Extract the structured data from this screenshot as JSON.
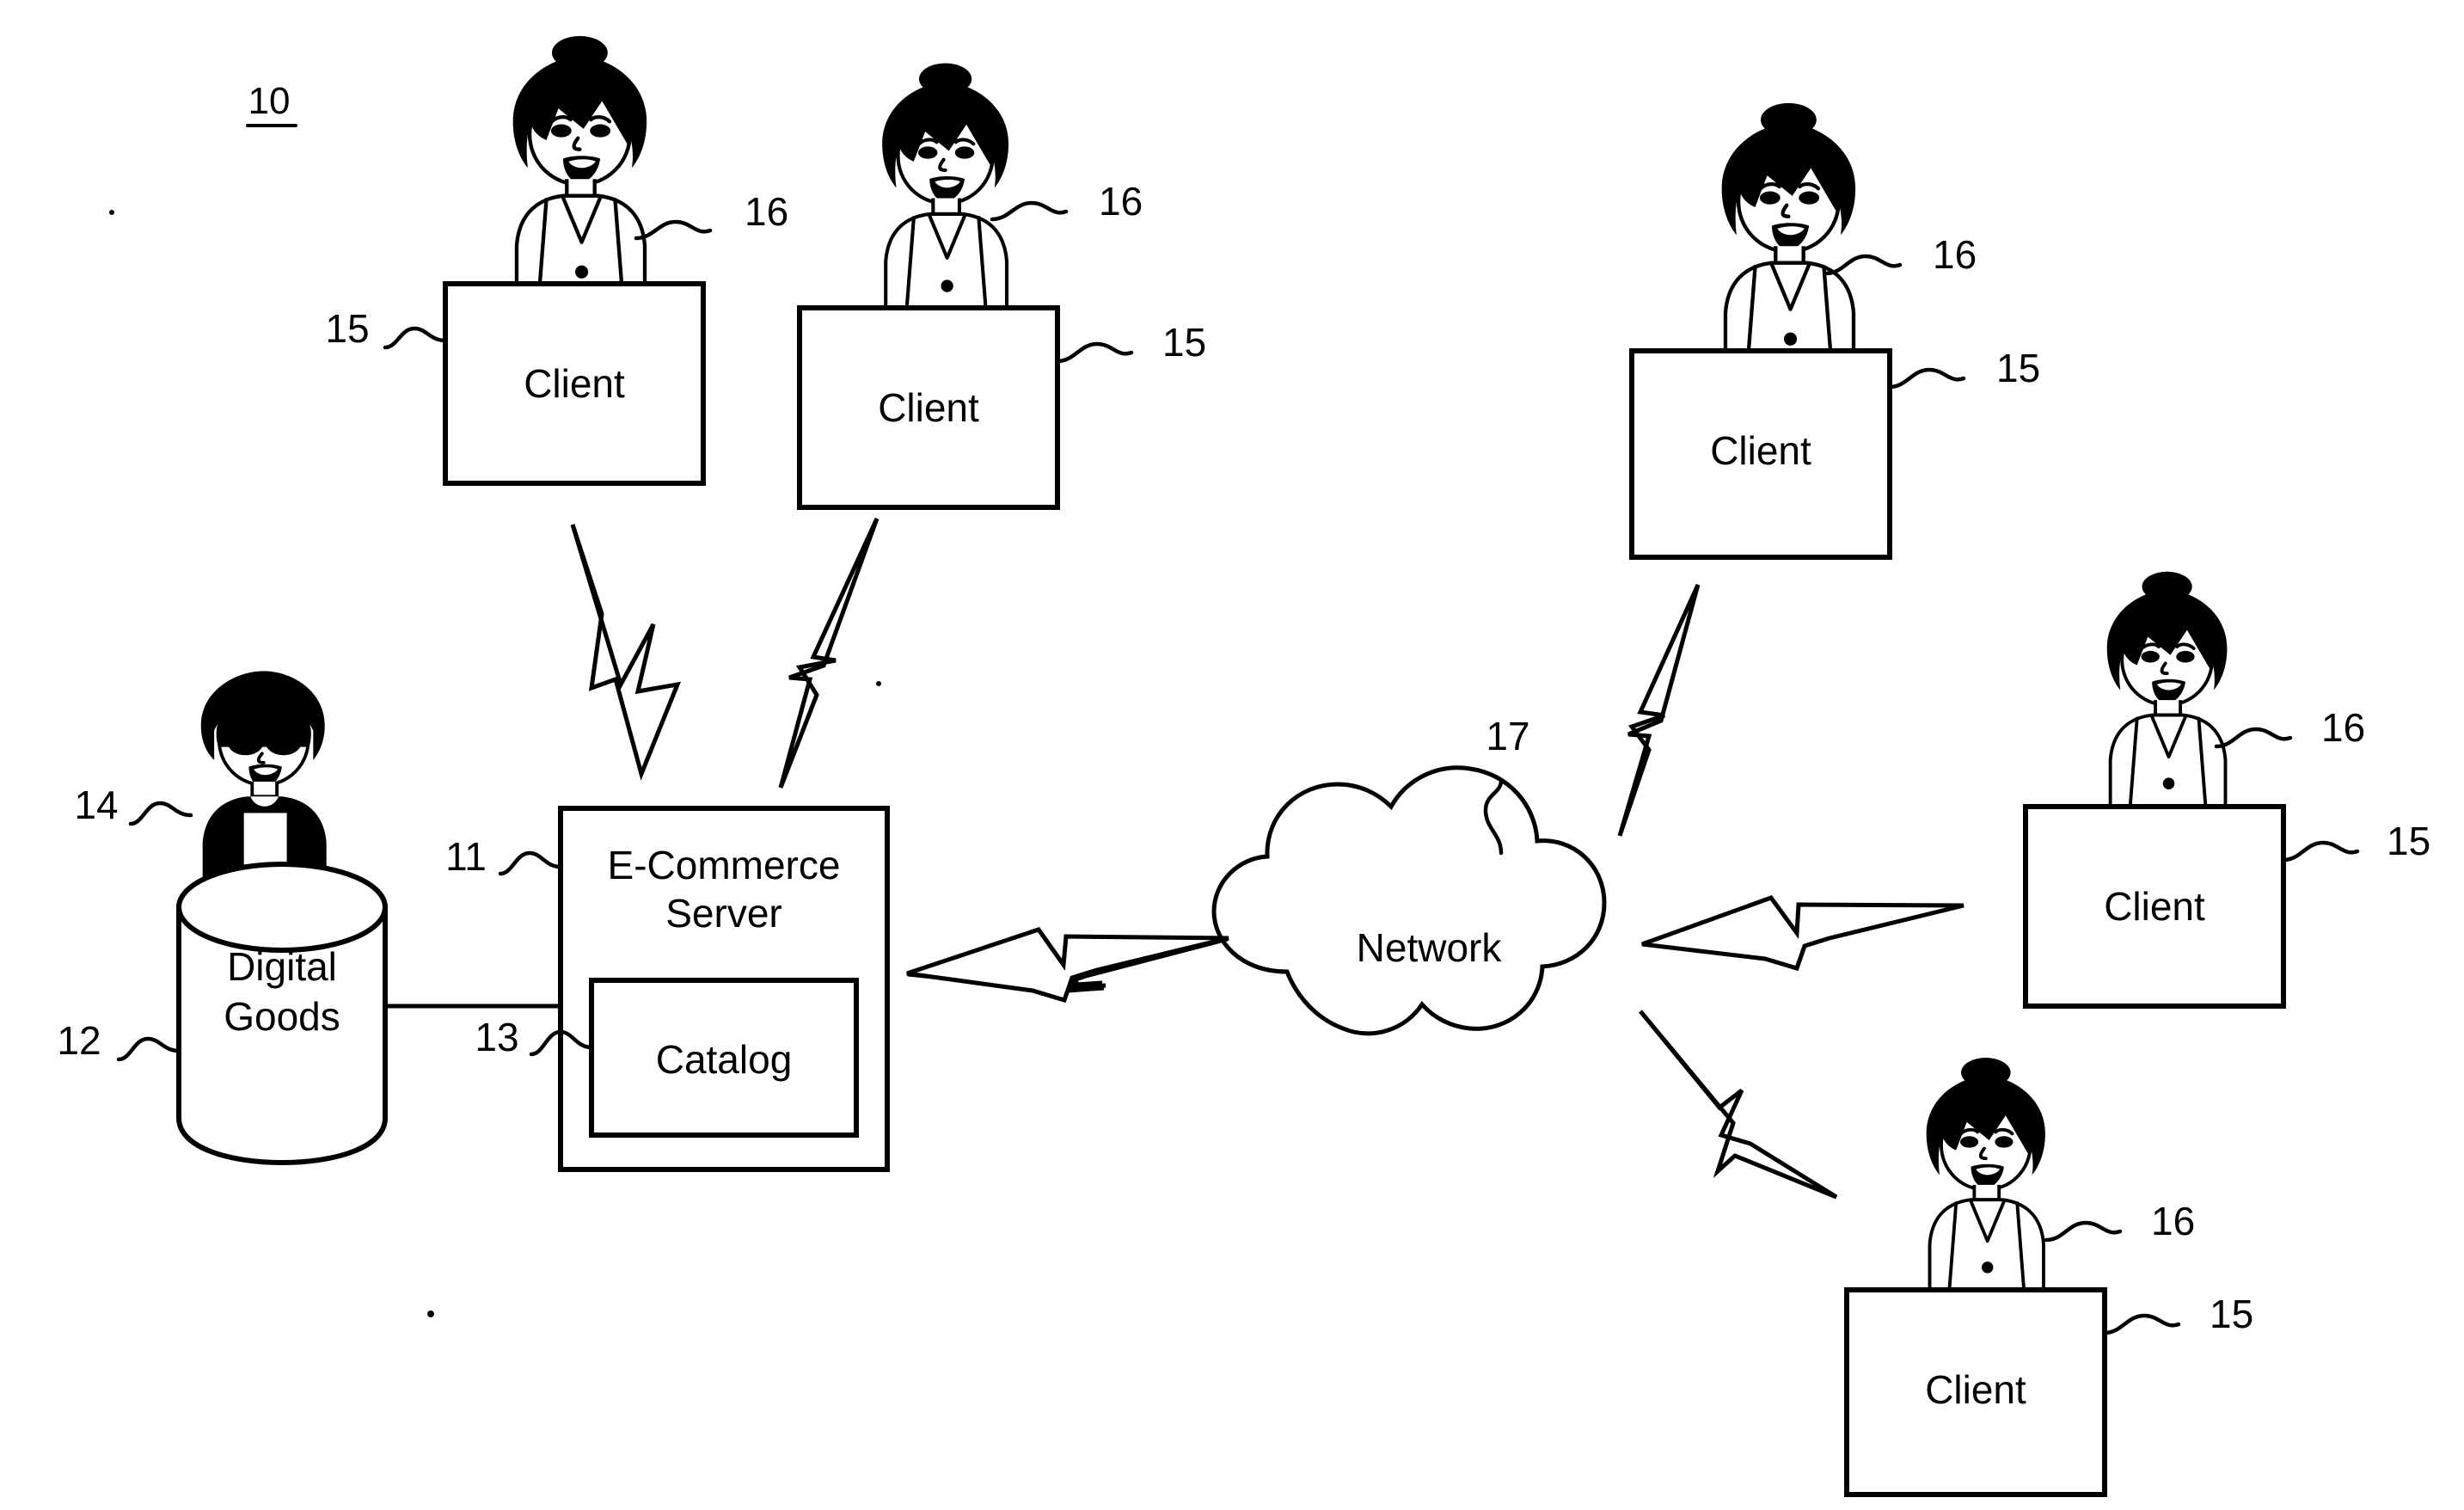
{
  "figure": {
    "id_label": "10",
    "background_color": "#ffffff",
    "line_color": "#000000"
  },
  "nodes": {
    "database": {
      "label_line1": "Digital",
      "label_line2": "Goods",
      "ref": "12",
      "operator_ref": "14",
      "icon": "database-cylinder-icon",
      "operator_icon": "merchant-person-icon"
    },
    "server": {
      "label_line1": "E-Commerce",
      "label_line2": "Server",
      "ref": "11",
      "icon": "server-box-icon"
    },
    "catalog": {
      "label": "Catalog",
      "ref": "13",
      "icon": "catalog-box-icon"
    },
    "network": {
      "label": "Network",
      "ref": "17",
      "icon": "cloud-icon"
    }
  },
  "clients": [
    {
      "label": "Client",
      "box_ref": "15",
      "user_ref": "16",
      "box_ref_side": "left",
      "user_ref_side": "right"
    },
    {
      "label": "Client",
      "box_ref": "15",
      "user_ref": "16",
      "box_ref_side": "right",
      "user_ref_side": "right"
    },
    {
      "label": "Client",
      "box_ref": "15",
      "user_ref": "16",
      "box_ref_side": "right",
      "user_ref_side": "right"
    },
    {
      "label": "Client",
      "box_ref": "15",
      "user_ref": "16",
      "box_ref_side": "right",
      "user_ref_side": "right"
    },
    {
      "label": "Client",
      "box_ref": "15",
      "user_ref": "16",
      "box_ref_side": "right",
      "user_ref_side": "right"
    }
  ],
  "links": [
    {
      "from": "client-1",
      "to": "server",
      "icon": "lightning-bolt-icon"
    },
    {
      "from": "client-2",
      "to": "server",
      "icon": "lightning-bolt-icon"
    },
    {
      "from": "server",
      "to": "network",
      "icon": "lightning-bolt-icon"
    },
    {
      "from": "network",
      "to": "client-3",
      "icon": "lightning-bolt-icon"
    },
    {
      "from": "network",
      "to": "client-4",
      "icon": "lightning-bolt-icon"
    },
    {
      "from": "network",
      "to": "client-5",
      "icon": "lightning-bolt-icon"
    },
    {
      "from": "database",
      "to": "server",
      "icon": "wire-line-icon"
    }
  ]
}
